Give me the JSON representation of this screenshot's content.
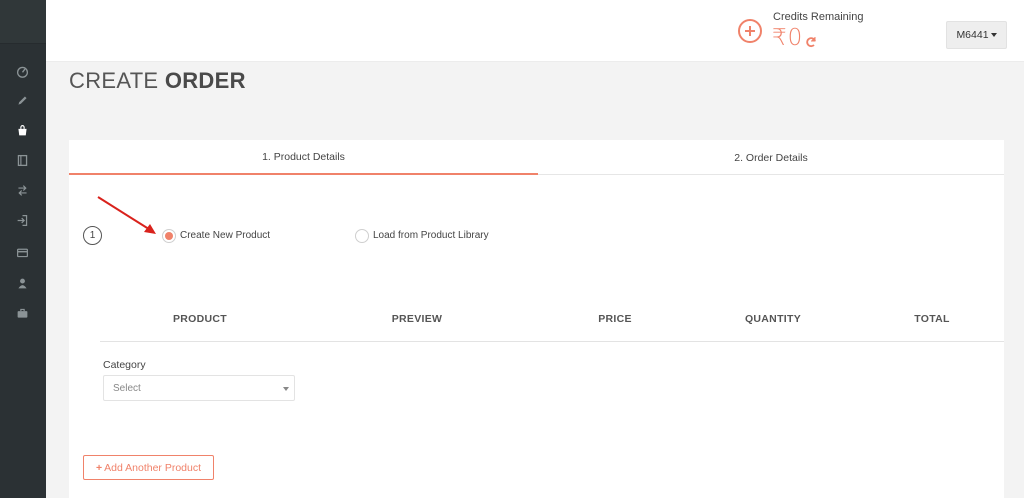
{
  "header": {
    "credits_label": "Credits Remaining",
    "credits_value": "₹0",
    "user_menu_label": "M6441"
  },
  "page": {
    "title_light": "CREATE",
    "title_bold": "ORDER"
  },
  "tabs": [
    {
      "label": "1. Product Details",
      "active": true
    },
    {
      "label": "2. Order Details",
      "active": false
    }
  ],
  "step": {
    "number": "1",
    "options": [
      {
        "label": "Create New Product",
        "selected": true
      },
      {
        "label": "Load from Product Library",
        "selected": false
      }
    ]
  },
  "table": {
    "columns": [
      "PRODUCT",
      "PREVIEW",
      "PRICE",
      "QUANTITY",
      "TOTAL"
    ]
  },
  "category": {
    "label": "Category",
    "selected_value": "Select"
  },
  "actions": {
    "add_another_label": "Add Another Product"
  },
  "sidebar": {
    "icons": [
      "dashboard-icon",
      "pencil-icon",
      "shopping-bag-icon",
      "book-icon",
      "transfer-icon",
      "sign-in-icon",
      "credit-card-icon",
      "user-icon",
      "briefcase-icon"
    ]
  },
  "colors": {
    "accent": "#f0826a",
    "sidebar_bg": "#2b3134",
    "annotation_arrow": "#d9221c"
  }
}
